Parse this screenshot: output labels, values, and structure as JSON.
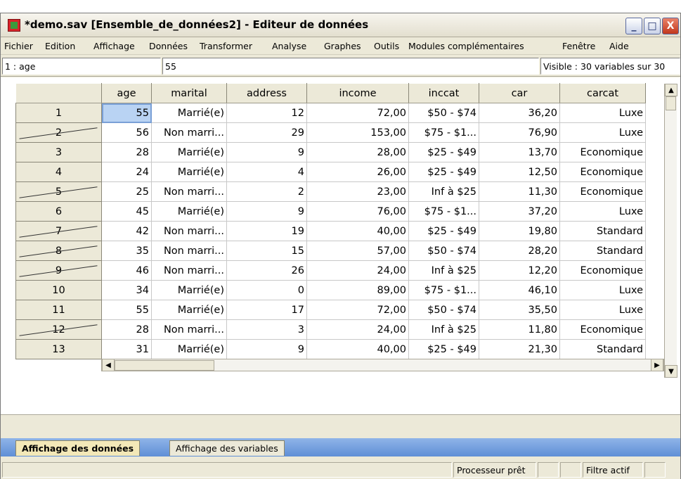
{
  "window": {
    "title": "*demo.sav [Ensemble_de_données2] - Editeur de données",
    "controls": {
      "minimize": "_",
      "maximize": "□",
      "close": "X"
    }
  },
  "menu": [
    "Fichier",
    "Edition",
    "Affichage",
    "Données",
    "Transformer",
    "Analyse",
    "Graphes",
    "Outils",
    "Modules complémentaires",
    "Fenêtre",
    "Aide"
  ],
  "cellbar": {
    "ref": "1 : age",
    "value": "55",
    "visible": "Visible : 30 variables sur 30"
  },
  "grid": {
    "columns": [
      "age",
      "marital",
      "address",
      "income",
      "inccat",
      "car",
      "carcat"
    ],
    "rows": [
      {
        "n": "1",
        "age": "55",
        "marital": "Marrié(e)",
        "address": "12",
        "income": "72,00",
        "inccat": "$50 - $74",
        "car": "36,20",
        "carcat": "Luxe",
        "crossed": false
      },
      {
        "n": "2",
        "age": "56",
        "marital": "Non marri...",
        "address": "29",
        "income": "153,00",
        "inccat": "$75 - $1...",
        "car": "76,90",
        "carcat": "Luxe",
        "crossed": true
      },
      {
        "n": "3",
        "age": "28",
        "marital": "Marrié(e)",
        "address": "9",
        "income": "28,00",
        "inccat": "$25 - $49",
        "car": "13,70",
        "carcat": "Economique",
        "crossed": false
      },
      {
        "n": "4",
        "age": "24",
        "marital": "Marrié(e)",
        "address": "4",
        "income": "26,00",
        "inccat": "$25 - $49",
        "car": "12,50",
        "carcat": "Economique",
        "crossed": false
      },
      {
        "n": "5",
        "age": "25",
        "marital": "Non marri...",
        "address": "2",
        "income": "23,00",
        "inccat": "Inf à $25",
        "car": "11,30",
        "carcat": "Economique",
        "crossed": true
      },
      {
        "n": "6",
        "age": "45",
        "marital": "Marrié(e)",
        "address": "9",
        "income": "76,00",
        "inccat": "$75 - $1...",
        "car": "37,20",
        "carcat": "Luxe",
        "crossed": false
      },
      {
        "n": "7",
        "age": "42",
        "marital": "Non marri...",
        "address": "19",
        "income": "40,00",
        "inccat": "$25 - $49",
        "car": "19,80",
        "carcat": "Standard",
        "crossed": true
      },
      {
        "n": "8",
        "age": "35",
        "marital": "Non marri...",
        "address": "15",
        "income": "57,00",
        "inccat": "$50 - $74",
        "car": "28,20",
        "carcat": "Standard",
        "crossed": true
      },
      {
        "n": "9",
        "age": "46",
        "marital": "Non marri...",
        "address": "26",
        "income": "24,00",
        "inccat": "Inf à $25",
        "car": "12,20",
        "carcat": "Economique",
        "crossed": true
      },
      {
        "n": "10",
        "age": "34",
        "marital": "Marrié(e)",
        "address": "0",
        "income": "89,00",
        "inccat": "$75 - $1...",
        "car": "46,10",
        "carcat": "Luxe",
        "crossed": false
      },
      {
        "n": "11",
        "age": "55",
        "marital": "Marrié(e)",
        "address": "17",
        "income": "72,00",
        "inccat": "$50 - $74",
        "car": "35,50",
        "carcat": "Luxe",
        "crossed": false
      },
      {
        "n": "12",
        "age": "28",
        "marital": "Non marri...",
        "address": "3",
        "income": "24,00",
        "inccat": "Inf à $25",
        "car": "11,80",
        "carcat": "Economique",
        "crossed": true
      },
      {
        "n": "13",
        "age": "31",
        "marital": "Marrié(e)",
        "address": "9",
        "income": "40,00",
        "inccat": "$25 - $49",
        "car": "21,30",
        "carcat": "Standard",
        "crossed": false
      }
    ]
  },
  "tabs": {
    "data_view": "Affichage des données",
    "variable_view": "Affichage des variables"
  },
  "status": {
    "processor": "Processeur prêt",
    "filter": "Filtre actif"
  }
}
